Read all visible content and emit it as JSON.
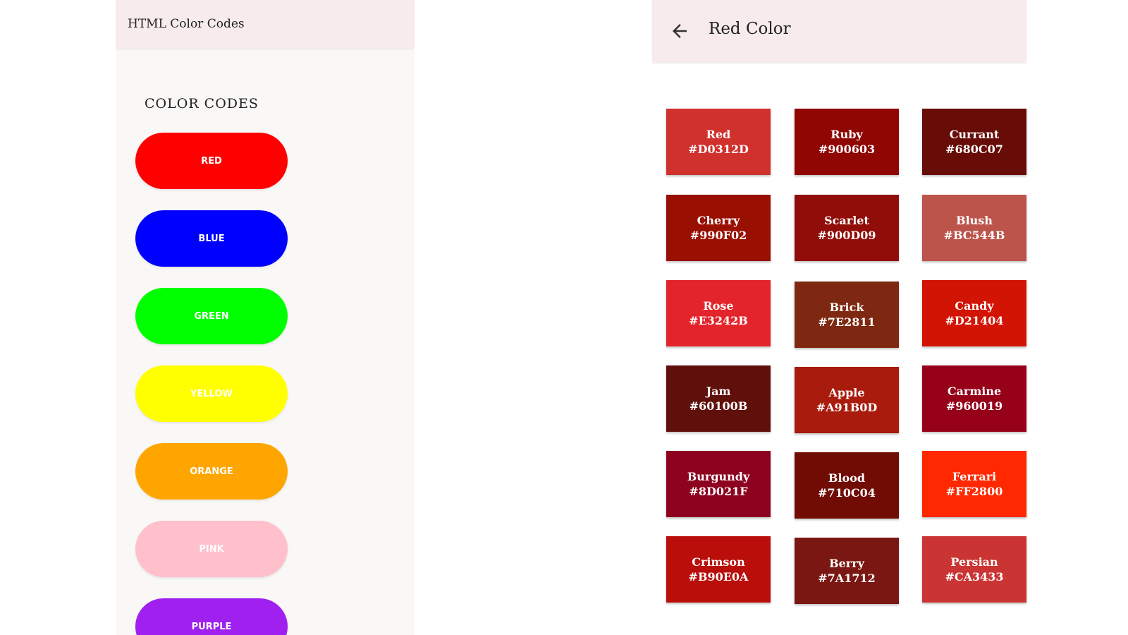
{
  "left": {
    "title": "HTML Color Codes",
    "section_title": "COLOR CODES",
    "buttons": [
      {
        "label": "RED",
        "color": "#ff0000"
      },
      {
        "label": "BLUE",
        "color": "#0000ff"
      },
      {
        "label": "GREEN",
        "color": "#00ff00"
      },
      {
        "label": "YELLOW",
        "color": "#ffff00"
      },
      {
        "label": "ORANGE",
        "color": "#ffa500"
      },
      {
        "label": "PINK",
        "color": "#ffc0cb"
      },
      {
        "label": "PURPLE",
        "color": "#a020f0"
      }
    ]
  },
  "right": {
    "title": "Red Color",
    "back_icon": "arrow-left-icon",
    "swatches": [
      {
        "name": "Red",
        "code": "#D0312D"
      },
      {
        "name": "Ruby",
        "code": "#900603"
      },
      {
        "name": "Currant",
        "code": "#680C07"
      },
      {
        "name": "Cherry",
        "code": "#990F02"
      },
      {
        "name": "Scarlet",
        "code": "#900D09"
      },
      {
        "name": "Blush",
        "code": "#BC544B"
      },
      {
        "name": "Rose",
        "code": "#E3242B"
      },
      {
        "name": "Brick",
        "code": "#7E2811"
      },
      {
        "name": "Candy",
        "code": "#D21404"
      },
      {
        "name": "Jam",
        "code": "#60100B"
      },
      {
        "name": "Apple",
        "code": "#A91B0D"
      },
      {
        "name": "Carmine",
        "code": "#960019"
      },
      {
        "name": "Burgundy",
        "code": "#8D021F"
      },
      {
        "name": "Blood",
        "code": "#710C04"
      },
      {
        "name": "Ferrari",
        "code": "#FF2800"
      },
      {
        "name": "Crimson",
        "code": "#B90E0A"
      },
      {
        "name": "Berry",
        "code": "#7A1712"
      },
      {
        "name": "Persian",
        "code": "#CA3433"
      }
    ]
  }
}
